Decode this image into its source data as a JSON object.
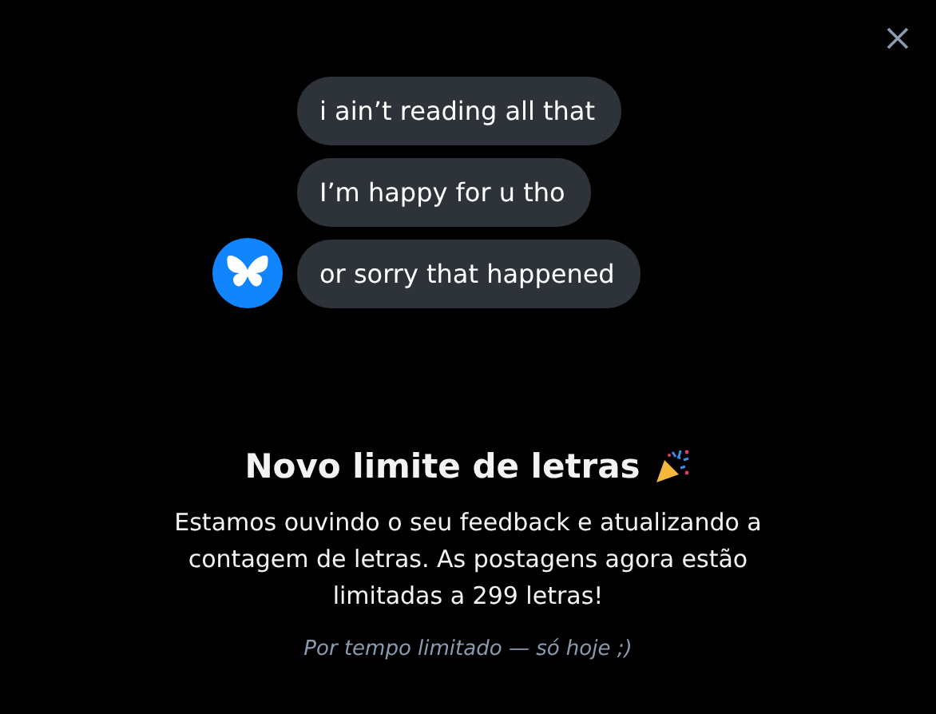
{
  "messages": [
    "i ain’t reading all that",
    "I’m happy for u tho",
    "or sorry that happened"
  ],
  "title": "Novo limite de letras",
  "body": "Estamos ouvindo o seu feedback e atualizando a contagem de letras. As postagens agora estão limitadas a 299 letras!",
  "footnote": "Por tempo limitado — só hoje ;)"
}
